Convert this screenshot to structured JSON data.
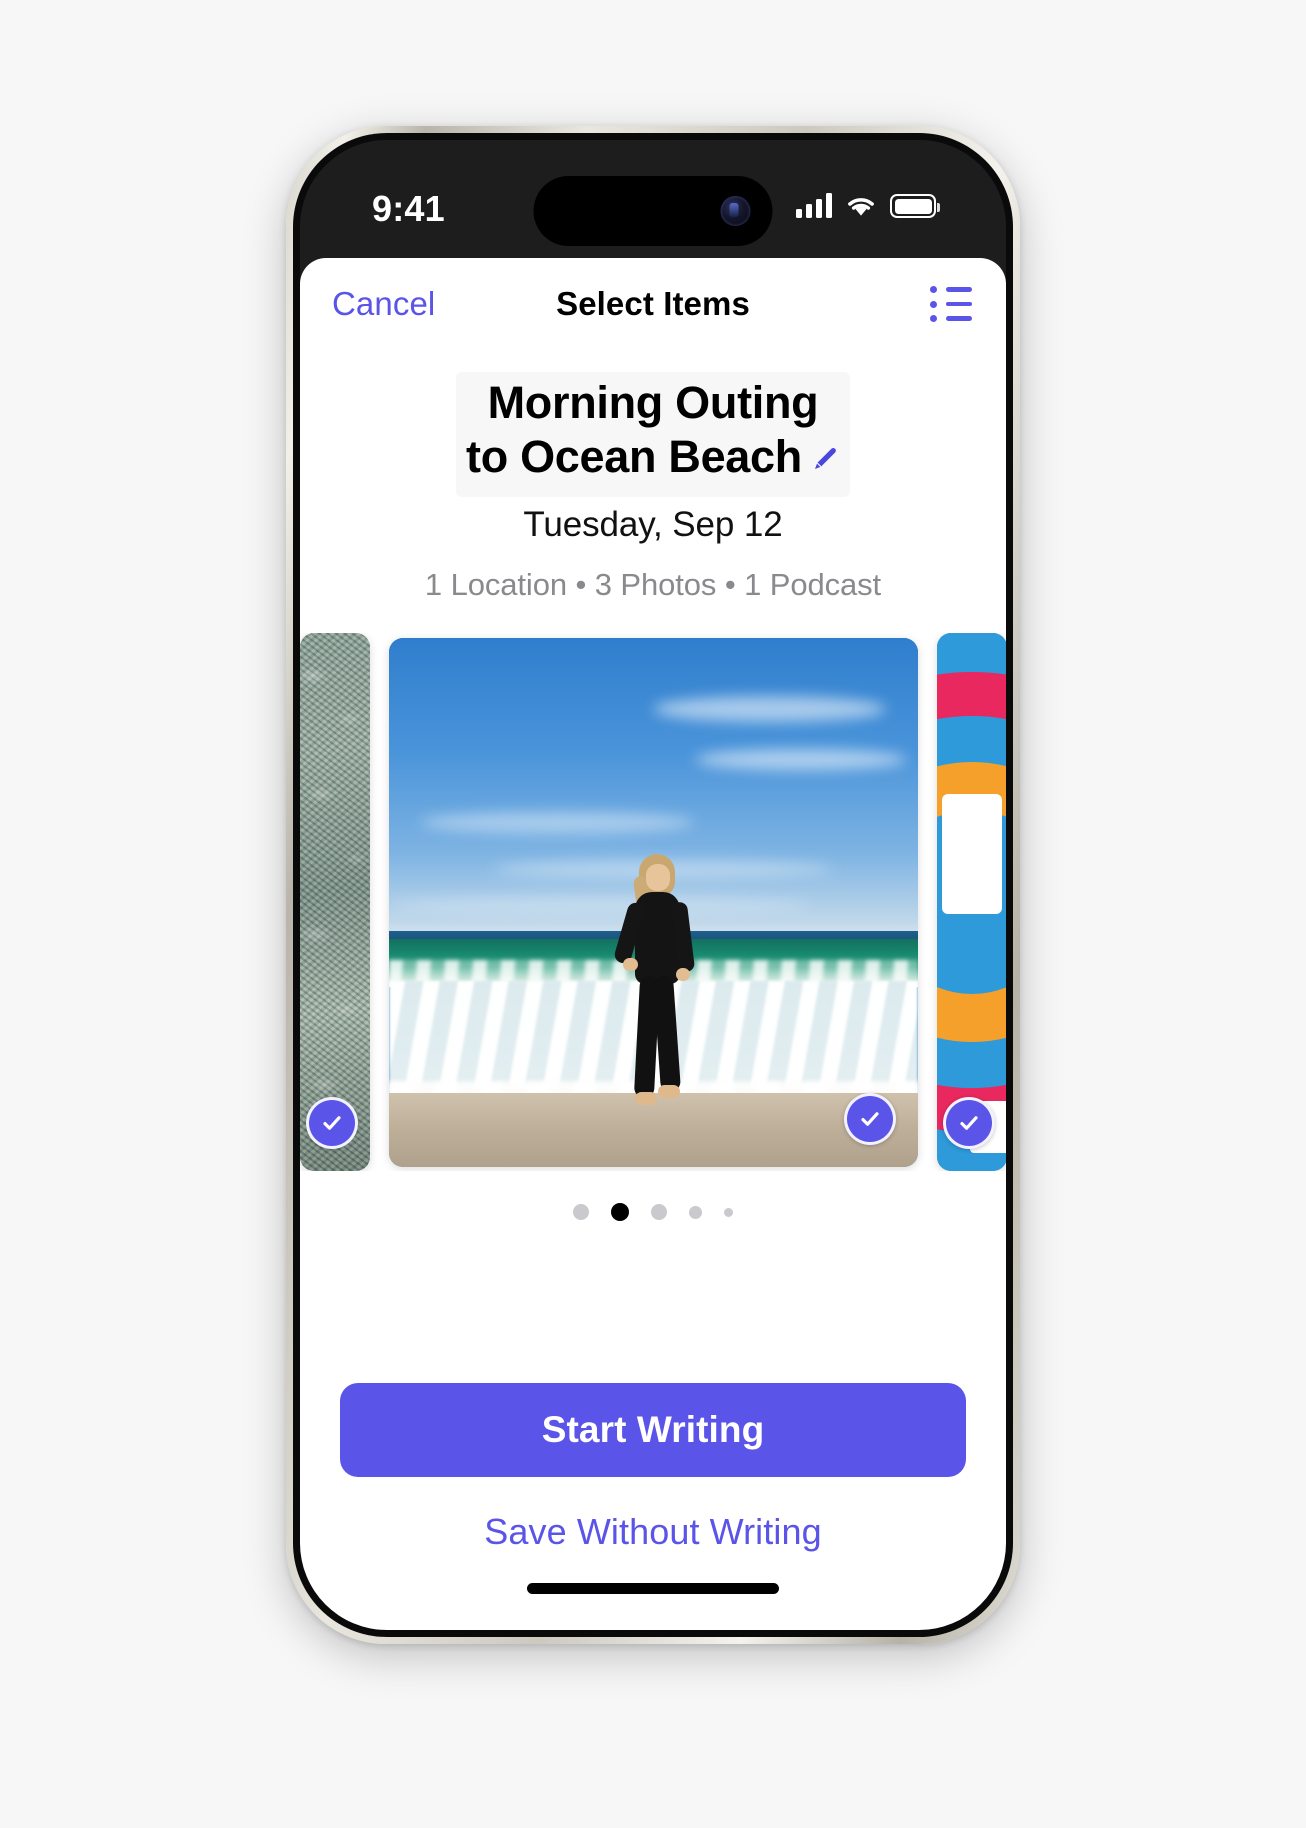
{
  "status_bar": {
    "time": "9:41",
    "signal_icon": "cellular-signal-icon",
    "wifi_icon": "wifi-icon",
    "battery_icon": "battery-icon"
  },
  "nav": {
    "cancel_label": "Cancel",
    "title": "Select Items",
    "list_icon": "list-bullet-icon"
  },
  "header": {
    "title": "Morning Outing to Ocean Beach",
    "title_line1": "Morning Outing",
    "title_line2": "to Ocean Beach",
    "edit_icon": "pencil-edit-icon",
    "date": "Tuesday, Sep 12",
    "meta": "1 Location • 3 Photos • 1 Podcast",
    "meta_parts": [
      "1 Location",
      "3 Photos",
      "1 Podcast"
    ]
  },
  "carousel": {
    "items": [
      {
        "name": "photo-moss-rocks",
        "kind": "photo",
        "selected": true,
        "position": "left-peek"
      },
      {
        "name": "photo-beach-runner",
        "kind": "photo",
        "selected": true,
        "position": "center"
      },
      {
        "name": "podcast-artwork",
        "kind": "podcast",
        "selected": true,
        "position": "right-peek"
      }
    ],
    "check_icon": "checkmark-icon",
    "page_count": 5,
    "active_page": 2
  },
  "footer": {
    "primary_label": "Start Writing",
    "secondary_label": "Save Without Writing"
  },
  "colors": {
    "accent": "#5B54E8",
    "button_fill": "#5B54E8",
    "nav_title": "#000000",
    "meta_text": "#8A8A8E",
    "page_background": "#F7F7F7",
    "app_background": "#FFFFFF",
    "status_bar": "#1D1D1D"
  }
}
